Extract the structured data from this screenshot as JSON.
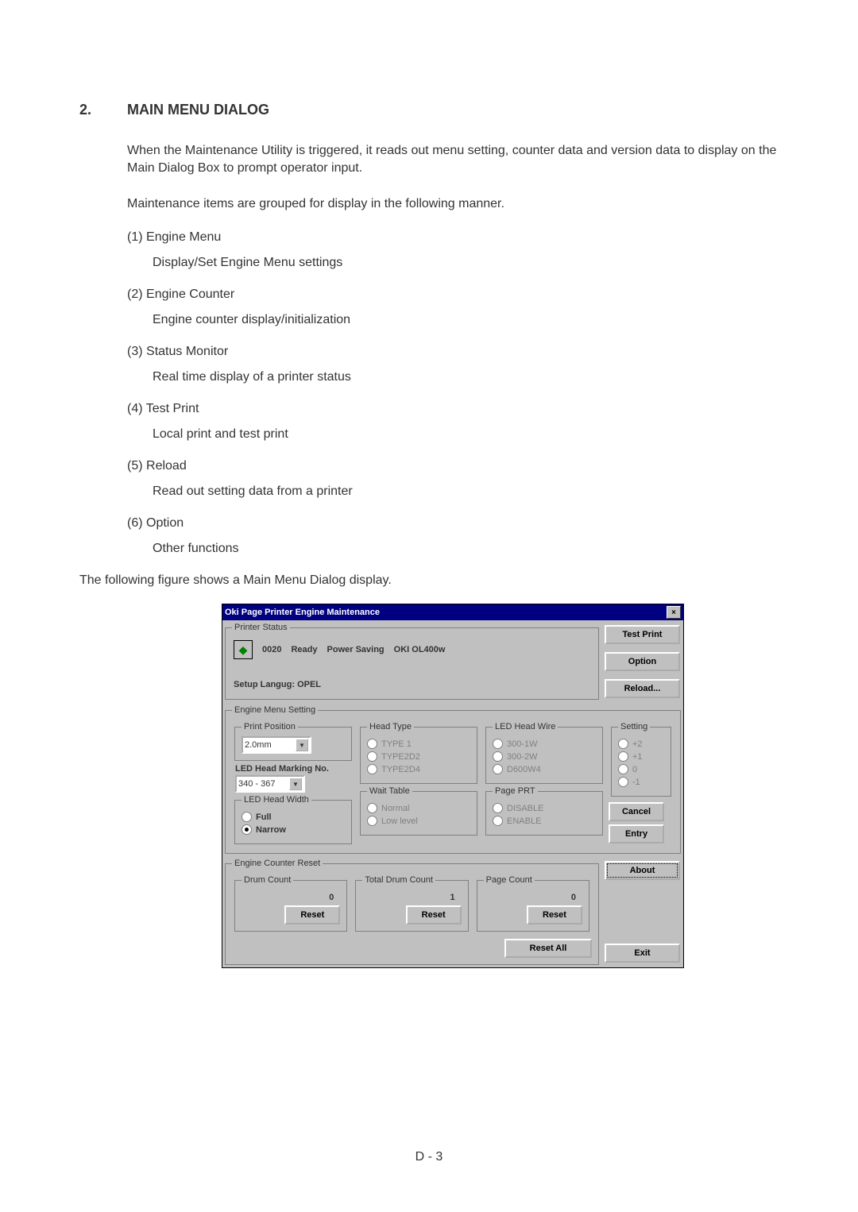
{
  "section": {
    "number": "2.",
    "title": "MAIN MENU DIALOG"
  },
  "para1": "When the Maintenance Utility is triggered, it reads out menu setting, counter data and version data to display on the Main Dialog Box to prompt operator input.",
  "para2": "Maintenance items are grouped for display in the following manner.",
  "items": [
    {
      "num": "(1)",
      "label": "Engine Menu",
      "desc": "Display/Set Engine Menu settings"
    },
    {
      "num": "(2)",
      "label": "Engine Counter",
      "desc": "Engine counter display/initialization"
    },
    {
      "num": "(3)",
      "label": "Status Monitor",
      "desc": "Real time display of a printer status"
    },
    {
      "num": "(4)",
      "label": "Test Print",
      "desc": "Local print and test print"
    },
    {
      "num": "(5)",
      "label": "Reload",
      "desc": "Read out setting data from a printer"
    },
    {
      "num": "(6)",
      "label": "Option",
      "desc": "Other functions"
    }
  ],
  "para3": "The following figure shows a Main Menu Dialog display.",
  "footer": "D - 3",
  "dlg": {
    "title": "Oki Page Printer Engine Maintenance",
    "close_x": "×",
    "printer_status_legend": "Printer Status",
    "code": "0020",
    "ready": "Ready",
    "power_saving": "Power Saving",
    "model": "OKI OL400w",
    "lang_label": "Setup Langug:",
    "lang_value": "OPEL",
    "btn_test_print": "Test Print",
    "btn_option": "Option",
    "btn_reload": "Reload...",
    "engine_menu_legend": "Engine Menu Setting",
    "print_position_legend": "Print Position",
    "print_position_value": "2.0mm",
    "led_marking_label": "LED Head Marking No.",
    "led_marking_value": "340 - 367",
    "led_width_legend": "LED Head Width",
    "led_width_full": "Full",
    "led_width_narrow": "Narrow",
    "head_type_legend": "Head Type",
    "head_type_1": "TYPE 1",
    "head_type_2": "TYPE2D2",
    "head_type_3": "TYPE2D4",
    "wait_table_legend": "Wait Table",
    "wait_normal": "Normal",
    "wait_low": "Low level",
    "led_wire_legend": "LED Head Wire",
    "led_wire_1": "300-1W",
    "led_wire_2": "300-2W",
    "led_wire_3": "D600W4",
    "page_prt_legend": "Page PRT",
    "page_disable": "DISABLE",
    "page_enable": "ENABLE",
    "setting_legend": "Setting",
    "setting_p2": "+2",
    "setting_p1": "+1",
    "setting_0": "0",
    "setting_m1": "-1",
    "btn_cancel": "Cancel",
    "btn_entry": "Entry",
    "engine_counter_legend": "Engine Counter Reset",
    "drum_count_legend": "Drum Count",
    "drum_count_val": "0",
    "total_drum_legend": "Total Drum Count",
    "total_drum_val": "1",
    "page_count_legend": "Page Count",
    "page_count_val": "0",
    "btn_reset": "Reset",
    "btn_reset_all": "Reset All",
    "btn_about": "About",
    "btn_exit": "Exit"
  }
}
